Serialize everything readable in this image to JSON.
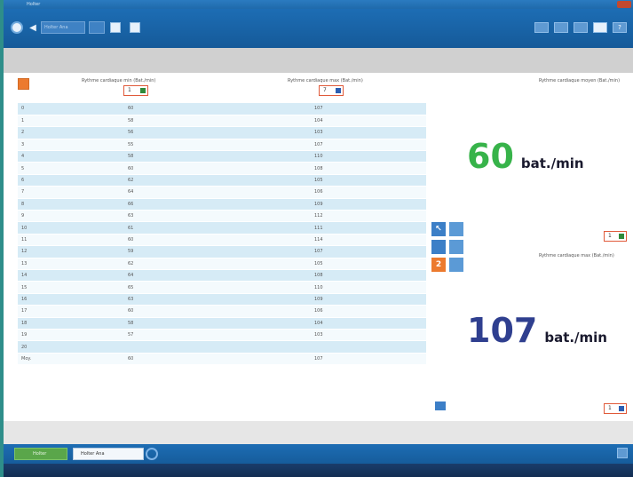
{
  "window": {
    "title": "Holter"
  },
  "toolbar": {
    "field_value": "Holter Ana"
  },
  "table": {
    "headers": [
      "Rythme cardiaque min (Bat./min)",
      "Rythme cardiaque max (Bat./min)"
    ],
    "min_select": "1",
    "max_select": "7",
    "rows": [
      [
        "0",
        "60",
        "107"
      ],
      [
        "1",
        "58",
        "104"
      ],
      [
        "2",
        "56",
        "103"
      ],
      [
        "3",
        "55",
        "107"
      ],
      [
        "4",
        "58",
        "110"
      ],
      [
        "5",
        "60",
        "108"
      ],
      [
        "6",
        "62",
        "105"
      ],
      [
        "7",
        "64",
        "106"
      ],
      [
        "8",
        "66",
        "109"
      ],
      [
        "9",
        "63",
        "112"
      ],
      [
        "10",
        "61",
        "111"
      ],
      [
        "11",
        "60",
        "114"
      ],
      [
        "12",
        "59",
        "107"
      ],
      [
        "13",
        "62",
        "105"
      ],
      [
        "14",
        "64",
        "108"
      ],
      [
        "15",
        "65",
        "110"
      ],
      [
        "16",
        "63",
        "109"
      ],
      [
        "17",
        "60",
        "106"
      ],
      [
        "18",
        "58",
        "104"
      ],
      [
        "19",
        "57",
        "103"
      ],
      [
        "20",
        "",
        ""
      ],
      [
        "Moy.",
        "60",
        "107"
      ]
    ]
  },
  "right": {
    "label_min": "Rythme cardiaque moyen (Bat./min)",
    "value_min": "60",
    "unit_min": "bat./min",
    "select_min": "1",
    "label_max": "Rythme cardiaque max (Bat./min)",
    "value_max": "107",
    "unit_max": "bat./min",
    "select_max": "1"
  },
  "side_buttons": {
    "number_label": "2"
  },
  "bottom": {
    "btn1_label": "Holter",
    "btn2_label": "Holter Ana"
  },
  "colors": {
    "min_value": "#37b34a",
    "max_value": "#2f3f8f",
    "accent_orange": "#ec7a2e",
    "toolbar_blue": "#1d6db4"
  }
}
